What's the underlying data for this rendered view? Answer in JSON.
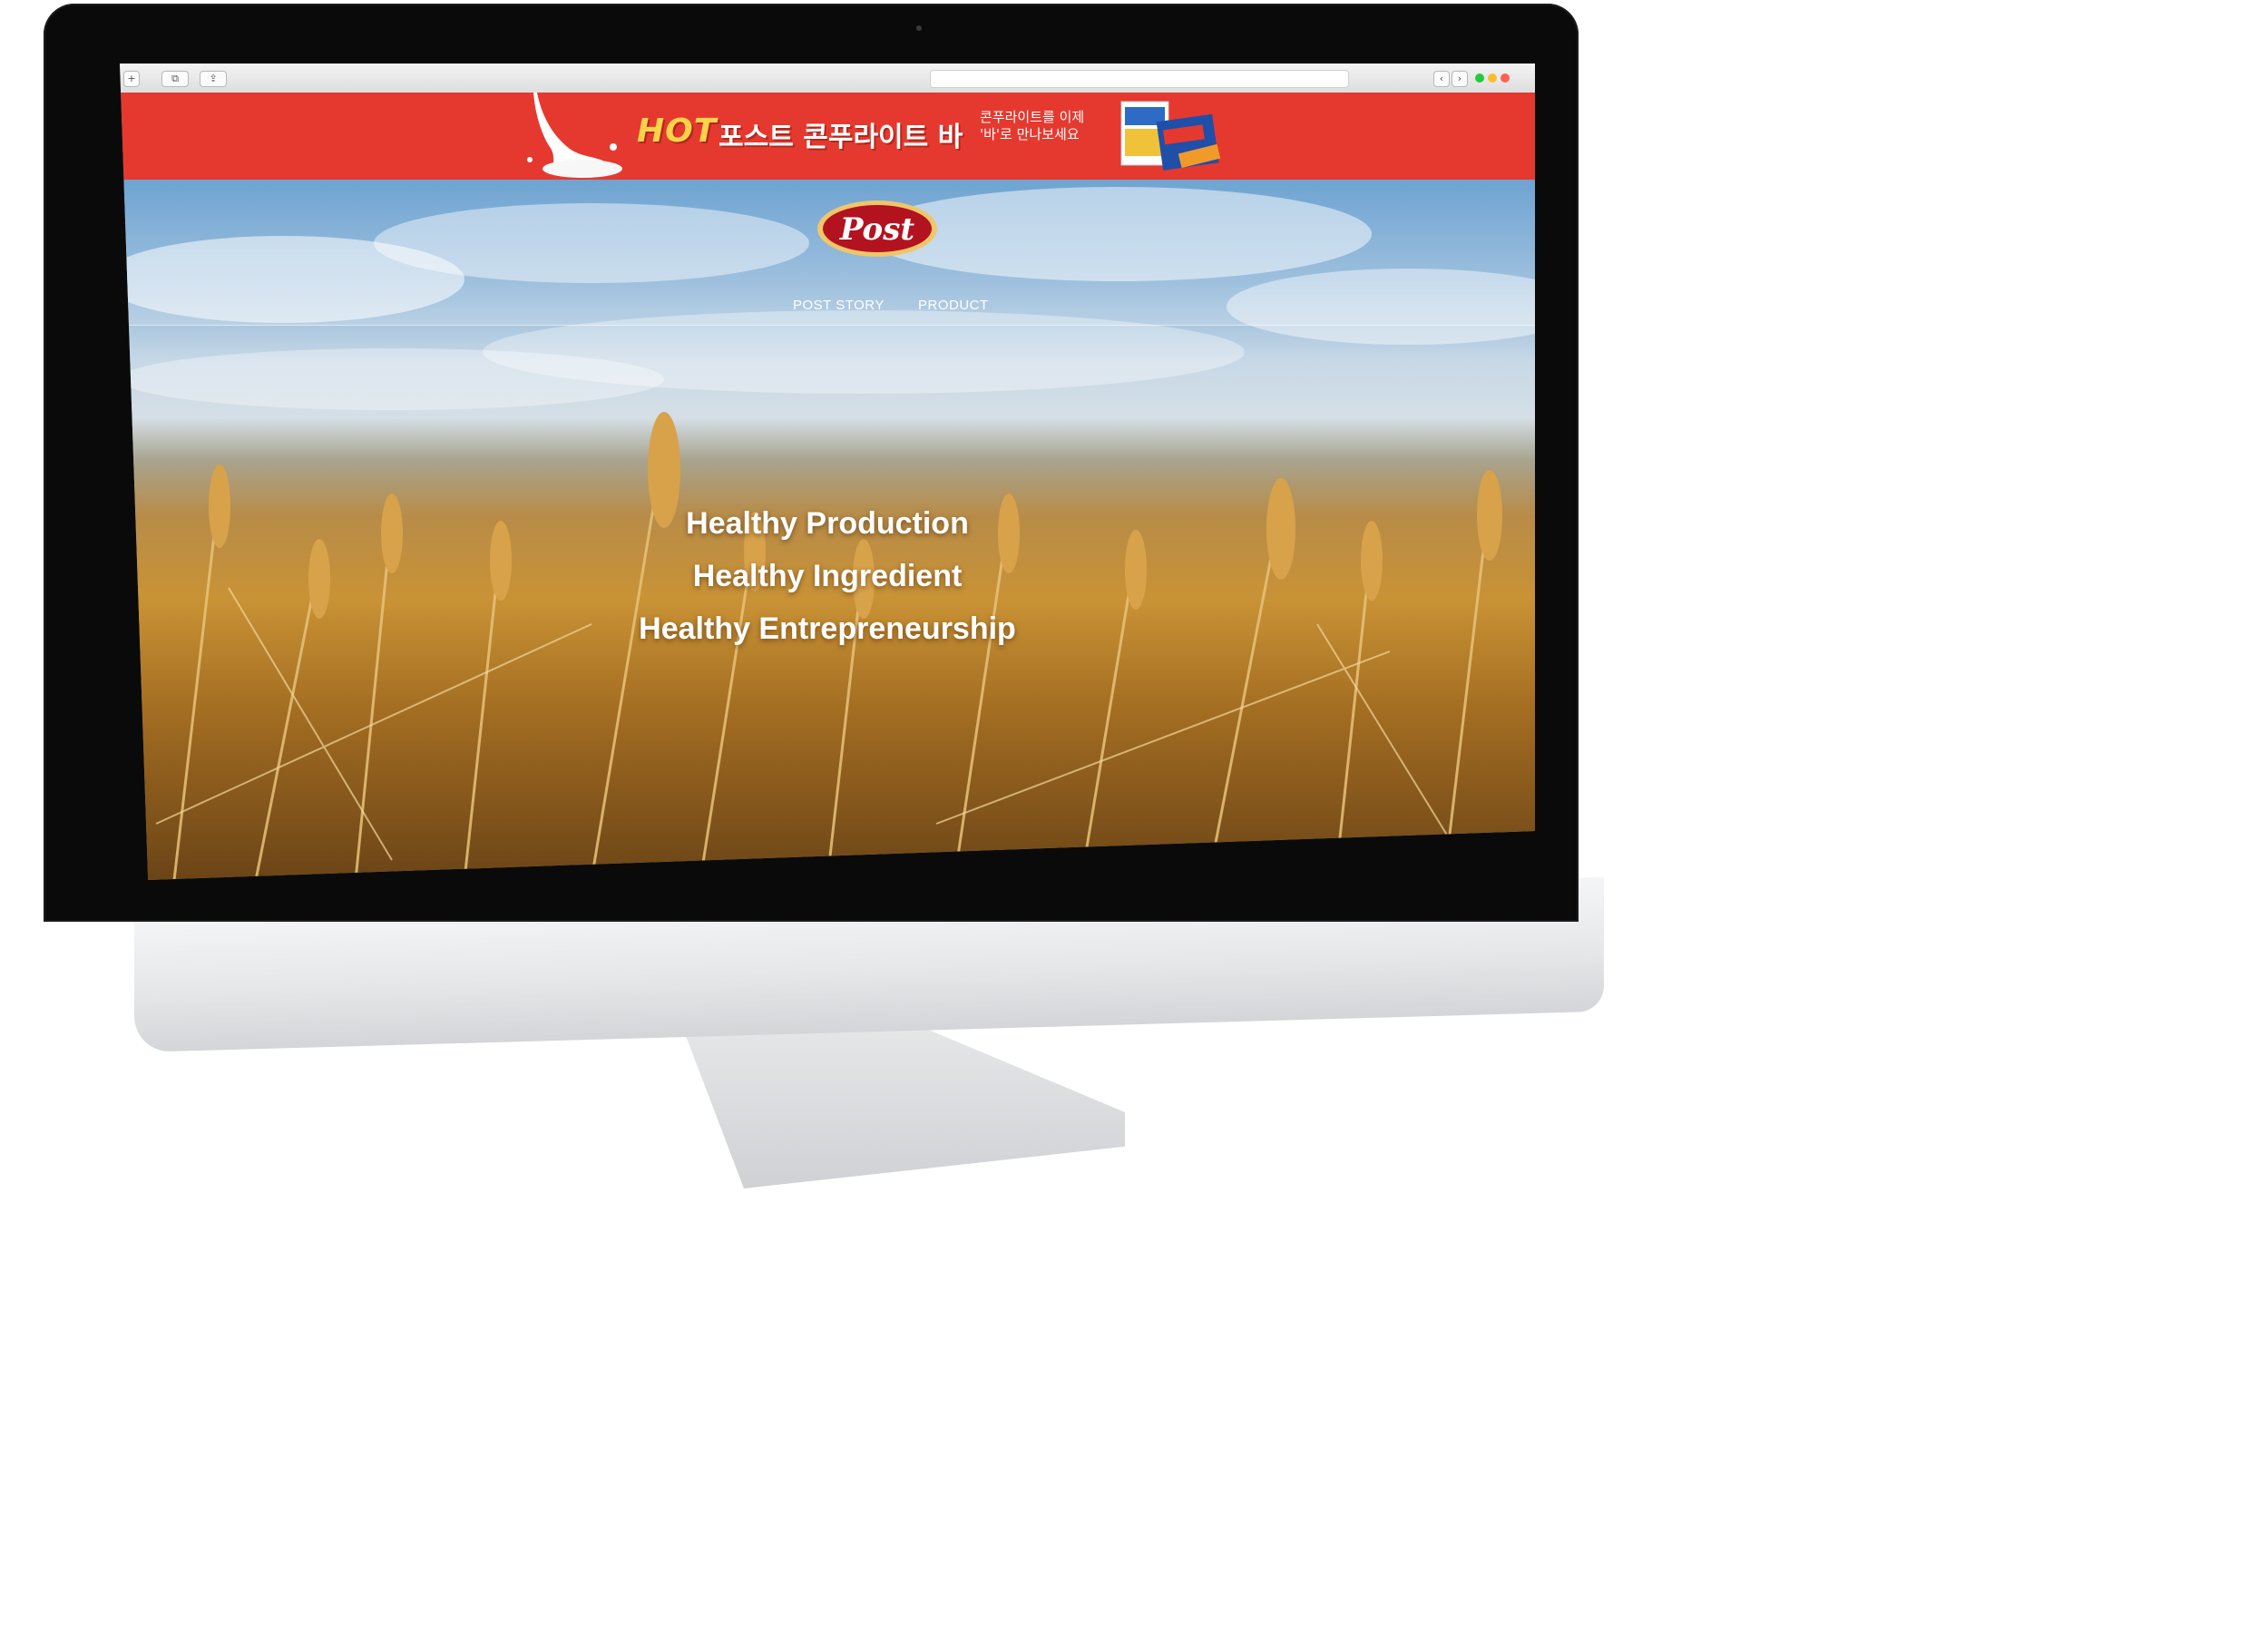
{
  "browser": {
    "new_tab_glyph": "+",
    "tabs_glyph": "⧉",
    "share_glyph": "⇪",
    "back_glyph": "‹",
    "forward_glyph": "›",
    "traffic_colors": [
      "#27c93f",
      "#ffbd2e",
      "#ff5f56"
    ]
  },
  "banner": {
    "hot_label": "HOT",
    "headline": "포스트 콘푸라이트 바",
    "sub_line_1": "콘푸라이트를 이제",
    "sub_line_2": "'바'로 만나보세요",
    "background_color": "#e5392f",
    "accent_color": "#ffd24a"
  },
  "site": {
    "logo_text": "Post",
    "nav": [
      "POST STORY",
      "PRODUCT"
    ],
    "taglines": [
      "Healthy Production",
      "Healthy Ingredient",
      "Healthy Entrepreneurship"
    ]
  },
  "icons": {
    "new_tab": "plus-icon",
    "tabs": "tabs-icon",
    "share": "share-icon",
    "back": "chevron-left-icon",
    "forward": "chevron-right-icon"
  }
}
